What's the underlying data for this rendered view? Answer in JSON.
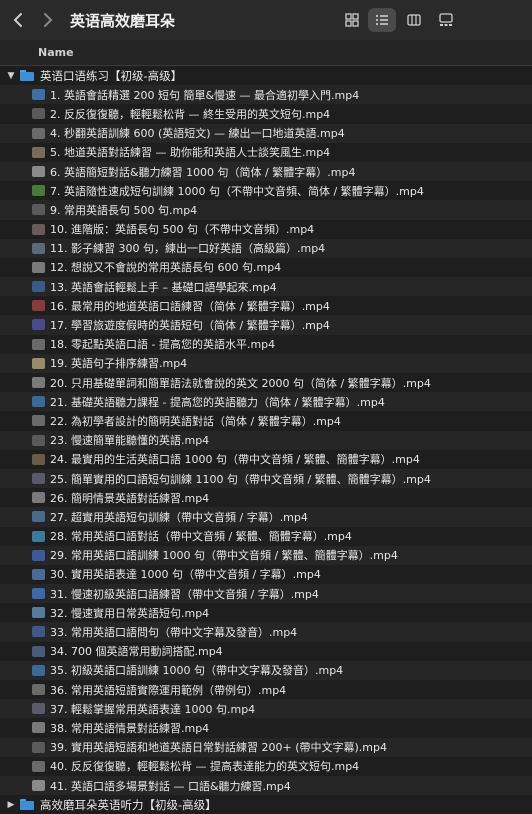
{
  "window": {
    "title": "英语高效磨耳朵",
    "back_icon": "chevron-left-icon",
    "forward_icon": "chevron-right-icon"
  },
  "views": [
    {
      "icon": "grid-view-icon",
      "active": false
    },
    {
      "icon": "list-view-icon",
      "active": true
    },
    {
      "icon": "column-view-icon",
      "active": false
    },
    {
      "icon": "gallery-view-icon",
      "active": false
    }
  ],
  "columns": {
    "name": "Name"
  },
  "folders": [
    {
      "label": "英语口语练习【初级-高级】",
      "expanded": true
    },
    {
      "label": "高效磨耳朵英语听力【初级-高级】",
      "expanded": false
    }
  ],
  "files": [
    {
      "label": "1. 英語會話精選 200 短句 簡單&慢速 — 最合適初學入門.mp4",
      "color": "#3d6fa8"
    },
    {
      "label": "2. 反反復復聽，輕輕鬆松背 — 終生受用的英文短句.mp4",
      "color": "#5a5a5a"
    },
    {
      "label": "4. 秒翻英語訓練 600 (英語短文) — 練出一口地道英語.mp4",
      "color": "#6a6a6a"
    },
    {
      "label": "5. 地道英語對話練習 — 助你能和英語人士談笑風生.mp4",
      "color": "#7a6a5a"
    },
    {
      "label": "6. 英語簡短對話&聽力練習 1000 句（简体 / 繁體字幕）.mp4",
      "color": "#8a8a8a"
    },
    {
      "label": "7. 英語隨性速成短句訓練 1000 句（不帶中文音頻、简体 / 繁體字幕）.mp4",
      "color": "#4a7a3a"
    },
    {
      "label": "9. 常用英語長句 500 句.mp4",
      "color": "#5a5a5a"
    },
    {
      "label": "10. 進階版：英語長句 500 句（不帶中文音頻）.mp4",
      "color": "#6a5a5a"
    },
    {
      "label": "11. 影子練習 300 句，練出一口好英語（高級篇）.mp4",
      "color": "#5a6a7a"
    },
    {
      "label": "12. 想說又不會說的常用英語長句 600 句.mp4",
      "color": "#7a7a7a"
    },
    {
      "label": "13. 英語會話輕鬆上手 – 基礎口語學起來.mp4",
      "color": "#3a5a8a"
    },
    {
      "label": "16. 最常用的地道英語口語練習（简体 / 繁體字幕）.mp4",
      "color": "#8a3a3a"
    },
    {
      "label": "17. 學習旅遊度假時的英語短句（简体 / 繁體字幕）.mp4",
      "color": "#4a4a8a"
    },
    {
      "label": "18. 零起點英語口語 - 提高您的英語水平.mp4",
      "color": "#6a6a6a"
    },
    {
      "label": "19. 英語句子排序練習.mp4",
      "color": "#9a8a6a"
    },
    {
      "label": "20. 只用基礎單詞和簡單語法就會說的英文 2000 句（简体 / 繁體字幕）.mp4",
      "color": "#7a7a7a"
    },
    {
      "label": "21. 基礎英語聽力課程 - 提高您的英語聽力（简体 / 繁體字幕）.mp4",
      "color": "#3a6a9a"
    },
    {
      "label": "22. 為初學者設計的簡明英語對話（简体 / 繁體字幕）.mp4",
      "color": "#6a6a6a"
    },
    {
      "label": "23. 慢速簡單能聽懂的英語.mp4",
      "color": "#5a5a5a"
    },
    {
      "label": "24. 最實用的生活英語口語 1000 句（帶中文音頻 / 繁體、簡體字幕）.mp4",
      "color": "#6a5a4a"
    },
    {
      "label": "25. 簡單實用的口語短句訓練 1100 句（帶中文音頻 / 繁體、簡體字幕）.mp4",
      "color": "#5a5a6a"
    },
    {
      "label": "26. 簡明情景英語對話練習.mp4",
      "color": "#7a7a7a"
    },
    {
      "label": "27. 超實用英語短句訓練（帶中文音頻 / 字幕）.mp4",
      "color": "#4a6a8a"
    },
    {
      "label": "28. 常用英語口語對話（帶中文音頻 / 繁體、簡體字幕）.mp4",
      "color": "#3a7a9a"
    },
    {
      "label": "29. 常用英語口語訓練 1000 句（帶中文音頻 / 繁體、簡體字幕）.mp4",
      "color": "#3a5a9a"
    },
    {
      "label": "30. 實用英語表達 1000 句（帶中文音頻 / 字幕）.mp4",
      "color": "#4a6a9a"
    },
    {
      "label": "31. 慢速初級英語口語練習（帶中文音頻 / 字幕）.mp4",
      "color": "#3a6aaa"
    },
    {
      "label": "32. 慢速實用日常英語短句.mp4",
      "color": "#5a7a9a"
    },
    {
      "label": "33. 常用英語口語問句（帶中文字幕及發音）.mp4",
      "color": "#3a5a8a"
    },
    {
      "label": "34. 700 個英語常用動詞搭配.mp4",
      "color": "#4a5a7a"
    },
    {
      "label": "35. 初級英語口語訓練 1000 句（帶中文字幕及發音）.mp4",
      "color": "#3a6a9a"
    },
    {
      "label": "36. 常用英語短語實際運用範例（帶例句）.mp4",
      "color": "#6a6a6a"
    },
    {
      "label": "37. 輕鬆掌握常用英語表達 1000 句.mp4",
      "color": "#5a5a6a"
    },
    {
      "label": "38. 常用英語情景對話練習.mp4",
      "color": "#7a7a7a"
    },
    {
      "label": "39. 實用英語短語和地道英語日常對話練習 200+ (帶中文字幕).mp4",
      "color": "#5a5a5a"
    },
    {
      "label": "40. 反反復復聽，輕輕鬆松背 — 提高表達能力的英文短句.mp4",
      "color": "#6a6a6a"
    },
    {
      "label": "41. 英語口語多場景對話 — 口語&聽力練習.mp4",
      "color": "#8a8a8a"
    }
  ]
}
